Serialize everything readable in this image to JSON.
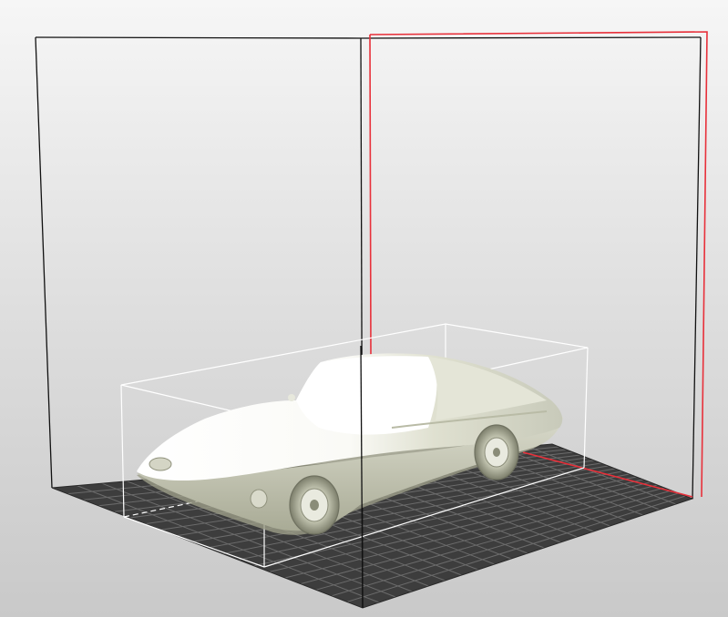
{
  "app": {
    "view": "3d-print-preview"
  },
  "scene": {
    "model": {
      "icon": "car-model-icon",
      "description_hidden": true
    },
    "colors": {
      "background_top": "#f6f6f6",
      "background_bottom": "#c9c9c9",
      "build_volume_edges": "#111111",
      "build_volume_highlight": "#e8303a",
      "bounding_box": "#ffffff",
      "model_light": "#ffffff",
      "model_shade": "#d3d4c3",
      "model_dark": "#9c9e88",
      "bed_grid": "#3d3d3d",
      "bed_grid_lines": "#6a6a6a"
    }
  }
}
